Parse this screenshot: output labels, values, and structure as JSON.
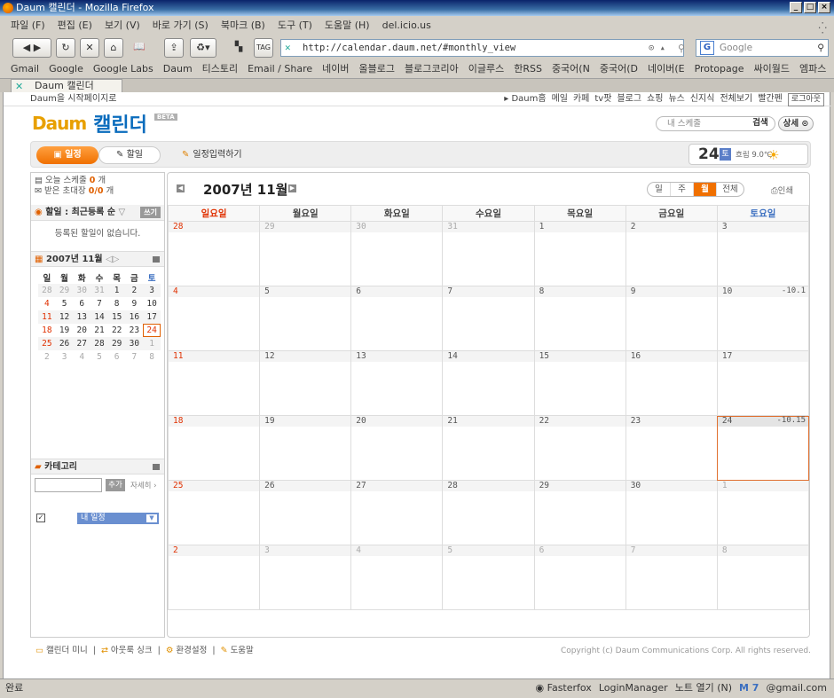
{
  "window": {
    "title": "Daum 캘린더 - Mozilla Firefox"
  },
  "menu": [
    "파일 (F)",
    "편집 (E)",
    "보기 (V)",
    "바로 가기 (S)",
    "북마크 (B)",
    "도구 (T)",
    "도움말 (H)",
    "del.icio.us"
  ],
  "nav": {
    "url": "http://calendar.daum.net/#monthly_view",
    "search_placeholder": "Google"
  },
  "bookmarks": [
    "Gmail",
    "Google",
    "Google Labs",
    "Daum",
    "티스토리",
    "Email / Share",
    "네이버",
    "올블로그",
    "블로그코리아",
    "이글루스",
    "한RSS",
    "중국어(N",
    "중국어(D",
    "네이버(E",
    "Protopage",
    "싸이월드",
    "엠파스",
    "»"
  ],
  "tab": {
    "label": "Daum 캘린더"
  },
  "daum_top": {
    "left": "Daum을 시작페이지로",
    "right": [
      "▸ Daum홈",
      "메일",
      "카페",
      "tv팟",
      "블로그",
      "쇼핑",
      "뉴스",
      "신지식",
      "전체보기",
      "빨간펜"
    ],
    "logout": "로그아웃"
  },
  "header": {
    "logo_daum": "Daum",
    "logo_text": "캘린더",
    "beta": "BETA",
    "search_placeholder": "내 스케줄",
    "search_btn": "검색",
    "detail_btn": "상세 ⊙"
  },
  "toolbar": {
    "tab_schedule": "일정",
    "tab_todo": "할일",
    "add_schedule": "일정입력하기"
  },
  "weather": {
    "day": "24",
    "dow": "토",
    "text": "흐림 9.0℃"
  },
  "sidebar": {
    "today_line1_pre": "오늘 스케줄 ",
    "today_count": "0",
    "today_line1_post": " 개",
    "inv_pre": "받은 초대장 ",
    "inv_count": "0/0",
    "inv_post": " 개",
    "todo_head": "할일 : 최근등록 순",
    "todo_btn": "쓰기",
    "todo_empty": "등록된 할일이 없습니다.",
    "mini_head": "2007년 11월",
    "cat_head": "카테고리",
    "cat_add": "추가",
    "cat_detail": "자세히 ›",
    "cat_item": "내 일정"
  },
  "minical": {
    "weekdays": [
      "일",
      "월",
      "화",
      "수",
      "목",
      "금",
      "토"
    ],
    "weeks": [
      [
        "28",
        "29",
        "30",
        "31",
        "1",
        "2",
        "3"
      ],
      [
        "4",
        "5",
        "6",
        "7",
        "8",
        "9",
        "10"
      ],
      [
        "11",
        "12",
        "13",
        "14",
        "15",
        "16",
        "17"
      ],
      [
        "18",
        "19",
        "20",
        "21",
        "22",
        "23",
        "24"
      ],
      [
        "25",
        "26",
        "27",
        "28",
        "29",
        "30",
        "1"
      ],
      [
        "2",
        "3",
        "4",
        "5",
        "6",
        "7",
        "8"
      ]
    ]
  },
  "calendar": {
    "month_label": "2007년 11월",
    "views": [
      "일",
      "주",
      "월",
      "전체"
    ],
    "active_view": "월",
    "print": "인쇄",
    "weekdays": [
      "일요일",
      "월요일",
      "화요일",
      "수요일",
      "목요일",
      "금요일",
      "토요일"
    ],
    "weeks": [
      [
        "28",
        "29",
        "30",
        "31",
        "1",
        "2",
        "3"
      ],
      [
        "4",
        "5",
        "6",
        "7",
        "8",
        "9",
        "10"
      ],
      [
        "11",
        "12",
        "13",
        "14",
        "15",
        "16",
        "17"
      ],
      [
        "18",
        "19",
        "20",
        "21",
        "22",
        "23",
        "24"
      ],
      [
        "25",
        "26",
        "27",
        "28",
        "29",
        "30",
        "1"
      ],
      [
        "2",
        "3",
        "4",
        "5",
        "6",
        "7",
        "8"
      ]
    ],
    "lunar_10": "-10.1",
    "lunar_24": "-10.15"
  },
  "footer": {
    "links": [
      "캘린더 미니",
      "아웃룩 싱크",
      "환경설정",
      "도움말"
    ],
    "copyright": "Copyright (c) Daum Communications Corp. All rights reserved."
  },
  "status": {
    "left": "완료",
    "right": [
      "Fasterfox",
      "LoginManager",
      "노트 열기 (N)",
      "7",
      "@gmail.com"
    ]
  }
}
